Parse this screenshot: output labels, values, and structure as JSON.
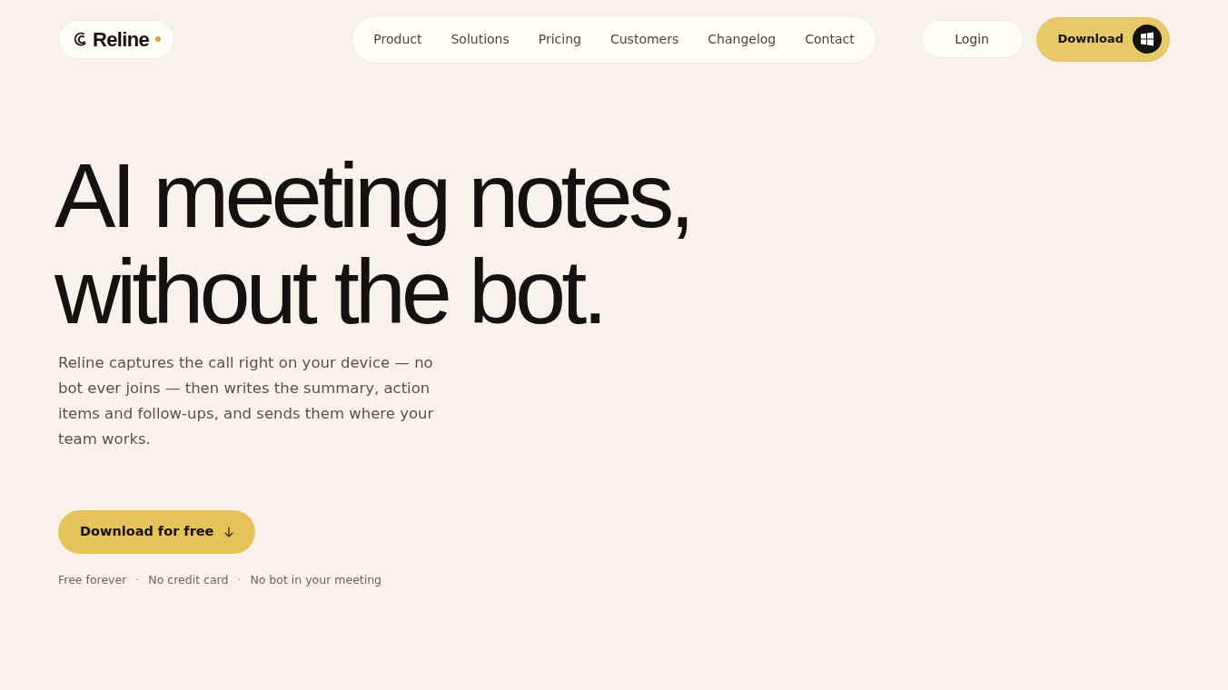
{
  "header": {
    "logo": {
      "name": "Reline"
    },
    "nav": [
      {
        "label": "Product"
      },
      {
        "label": "Solutions"
      },
      {
        "label": "Pricing"
      },
      {
        "label": "Customers"
      },
      {
        "label": "Changelog"
      },
      {
        "label": "Contact"
      }
    ],
    "login_button": "Login",
    "download_button": "Download"
  },
  "hero": {
    "headline_lines": [
      "AI meeting notes,",
      "without the bot."
    ],
    "description": "Reline captures the call right on your device — no bot ever joins — then writes the summary, action items and follow-ups, and sends them where your team works.",
    "cta": "Download for free",
    "notes": [
      "Free forever",
      "No credit card",
      "No bot in your meeting"
    ],
    "separator": "·"
  }
}
